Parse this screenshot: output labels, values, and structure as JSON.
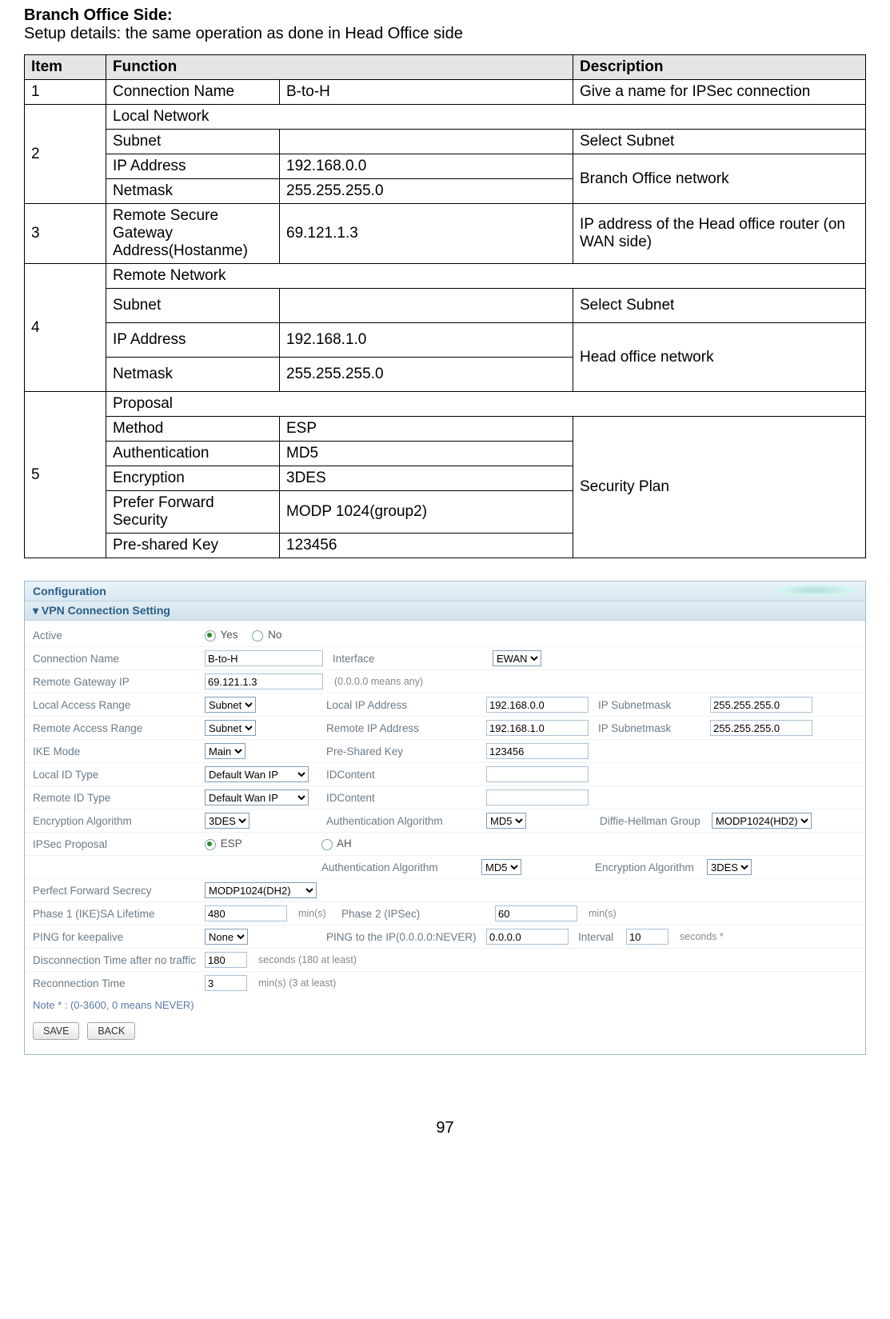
{
  "heading": {
    "title": "Branch Office Side:",
    "subtitle": "Setup details: the same operation as done in Head Office side"
  },
  "spec": {
    "headers": {
      "item": "Item",
      "func": "Function",
      "desc": "Description"
    },
    "r1": {
      "item": "1",
      "name": "Connection Name",
      "val": "B-to-H",
      "desc": "Give a name for IPSec connection"
    },
    "r2": {
      "item": "2",
      "header": "Local Network",
      "subnet": {
        "name": "Subnet",
        "val": "",
        "desc": "Select Subnet"
      },
      "ip": {
        "name": "IP Address",
        "val": "192.168.0.0"
      },
      "mask": {
        "name": "Netmask",
        "val": "255.255.255.0"
      },
      "netdesc": "Branch Office network"
    },
    "r3": {
      "item": "3",
      "name": "Remote Secure Gateway Address(Hostanme)",
      "val": "69.121.1.3",
      "desc": "IP address of the Head office router (on WAN side)"
    },
    "r4": {
      "item": "4",
      "header": "Remote Network",
      "subnet": {
        "name": "Subnet",
        "val": "",
        "desc": "Select Subnet"
      },
      "ip": {
        "name": "IP Address",
        "val": "192.168.1.0"
      },
      "mask": {
        "name": "Netmask",
        "val": "255.255.255.0"
      },
      "netdesc": "Head office network"
    },
    "r5": {
      "item": "5",
      "header": "Proposal",
      "method": {
        "name": "Method",
        "val": "ESP"
      },
      "auth": {
        "name": "Authentication",
        "val": "MD5"
      },
      "enc": {
        "name": "Encryption",
        "val": "3DES"
      },
      "pfs": {
        "name": "Prefer Forward Security",
        "val": "MODP 1024(group2)"
      },
      "psk": {
        "name": "Pre-shared Key",
        "val": "123456"
      },
      "desc": "Security Plan"
    }
  },
  "shot": {
    "config": "Configuration",
    "section": "VPN Connection Setting",
    "rows": {
      "active": {
        "label": "Active",
        "yes": "Yes",
        "no": "No"
      },
      "conn": {
        "label": "Connection Name",
        "val": "B-to-H",
        "iface_label": "Interface",
        "iface_val": "EWAN"
      },
      "rgw": {
        "label": "Remote Gateway IP",
        "val": "69.121.1.3",
        "hint": "(0.0.0.0 means any)"
      },
      "lrange": {
        "label": "Local Access Range",
        "sel": "Subnet",
        "lip_label": "Local IP Address",
        "lip": "192.168.0.0",
        "mask_label": "IP Subnetmask",
        "mask": "255.255.255.0"
      },
      "rrange": {
        "label": "Remote Access Range",
        "sel": "Subnet",
        "rip_label": "Remote IP Address",
        "rip": "192.168.1.0",
        "mask_label": "IP Subnetmask",
        "mask": "255.255.255.0"
      },
      "ike": {
        "label": "IKE Mode",
        "sel": "Main",
        "psk_label": "Pre-Shared Key",
        "psk": "123456"
      },
      "lid": {
        "label": "Local ID Type",
        "sel": "Default Wan IP",
        "idc_label": "IDContent",
        "idc": ""
      },
      "rid": {
        "label": "Remote ID Type",
        "sel": "Default Wan IP",
        "idc_label": "IDContent",
        "idc": ""
      },
      "encalg": {
        "label": "Encryption Algorithm",
        "sel": "3DES",
        "auth_label": "Authentication Algorithm",
        "auth_sel": "MD5",
        "dh_label": "Diffie-Hellman Group",
        "dh_sel": "MODP1024(HD2)"
      },
      "ipsecprop": {
        "label": "IPSec Proposal",
        "esp": "ESP",
        "ah": "AH"
      },
      "ipsecauth": {
        "label": "",
        "auth_label": "Authentication Algorithm",
        "auth_sel": "MD5",
        "enc_label": "Encryption Algorithm",
        "enc_sel": "3DES"
      },
      "pfs": {
        "label": "Perfect Forward Secrecy",
        "sel": "MODP1024(DH2)"
      },
      "p1": {
        "label": "Phase 1 (IKE)SA Lifetime",
        "val": "480",
        "unit": "min(s)",
        "p2_label": "Phase 2 (IPSec)",
        "p2_val": "60",
        "p2_unit": "min(s)"
      },
      "ping": {
        "label": "PING for keepalive",
        "sel": "None",
        "toip_label": "PING to the IP(0.0.0.0:NEVER)",
        "toip": "0.0.0.0",
        "int_label": "Interval",
        "int_val": "10",
        "int_unit": "seconds *"
      },
      "disc": {
        "label": "Disconnection Time after no traffic",
        "val": "180",
        "unit": "seconds (180 at least)"
      },
      "recon": {
        "label": "Reconnection Time",
        "val": "3",
        "unit": "min(s) (3 at least)"
      }
    },
    "note": "Note * : (0-3600, 0 means NEVER)",
    "buttons": {
      "save": "SAVE",
      "back": "BACK"
    }
  },
  "page_number": "97"
}
